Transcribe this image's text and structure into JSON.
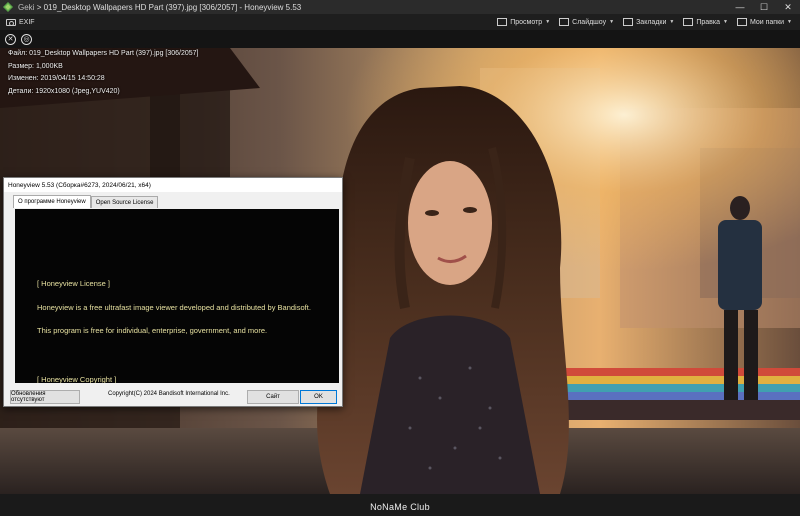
{
  "window": {
    "app_prefix": "Geki",
    "separator": ">",
    "title": "019_Desktop Wallpapers  HD Part (397).jpg [306/2057] - Honeyview 5.53",
    "controls": [
      "—",
      "☐",
      "✕"
    ]
  },
  "toolbar": {
    "exif_label": "EXIF",
    "menu": [
      {
        "label": "Просмотр",
        "icon": "view-icon"
      },
      {
        "label": "Слайдшоу",
        "icon": "slideshow-icon"
      },
      {
        "label": "Закладки",
        "icon": "bookmark-icon"
      },
      {
        "label": "Правка",
        "icon": "edit-icon"
      },
      {
        "label": "Мои папки",
        "icon": "folder-icon"
      }
    ]
  },
  "info": {
    "file": "Файл: 019_Desktop Wallpapers  HD Part (397).jpg [306/2057]",
    "size": "Размер: 1,000KB",
    "modified": "Изменен: 2019/04/15 14:50:28",
    "details": "Детали: 1920x1080 (Jpeg,YUV420)"
  },
  "dialog": {
    "title": "Honeyview 5.53 (Сборка#6273, 2024/06/21, x64)",
    "tabs": [
      "О программе Honeyview",
      "Open Source License"
    ],
    "lines": [
      "[ Honeyview License ]",
      "Honeyview is a free ultrafast image viewer developed and distributed by Bandisoft.",
      "This program is free for individual, enterprise, government, and more.",
      "[ Honeyview Copyright ]"
    ],
    "update_button": "Обновления отсутствуют",
    "copyright": "Copyright(C) 2024 Bandisoft International Inc.",
    "site_button": "Сайт",
    "ok_button": "OK"
  },
  "watermark": "NoNaMe Club",
  "colors": {
    "accent": "#0078d7",
    "dialog_text": "#e6e0a0"
  }
}
